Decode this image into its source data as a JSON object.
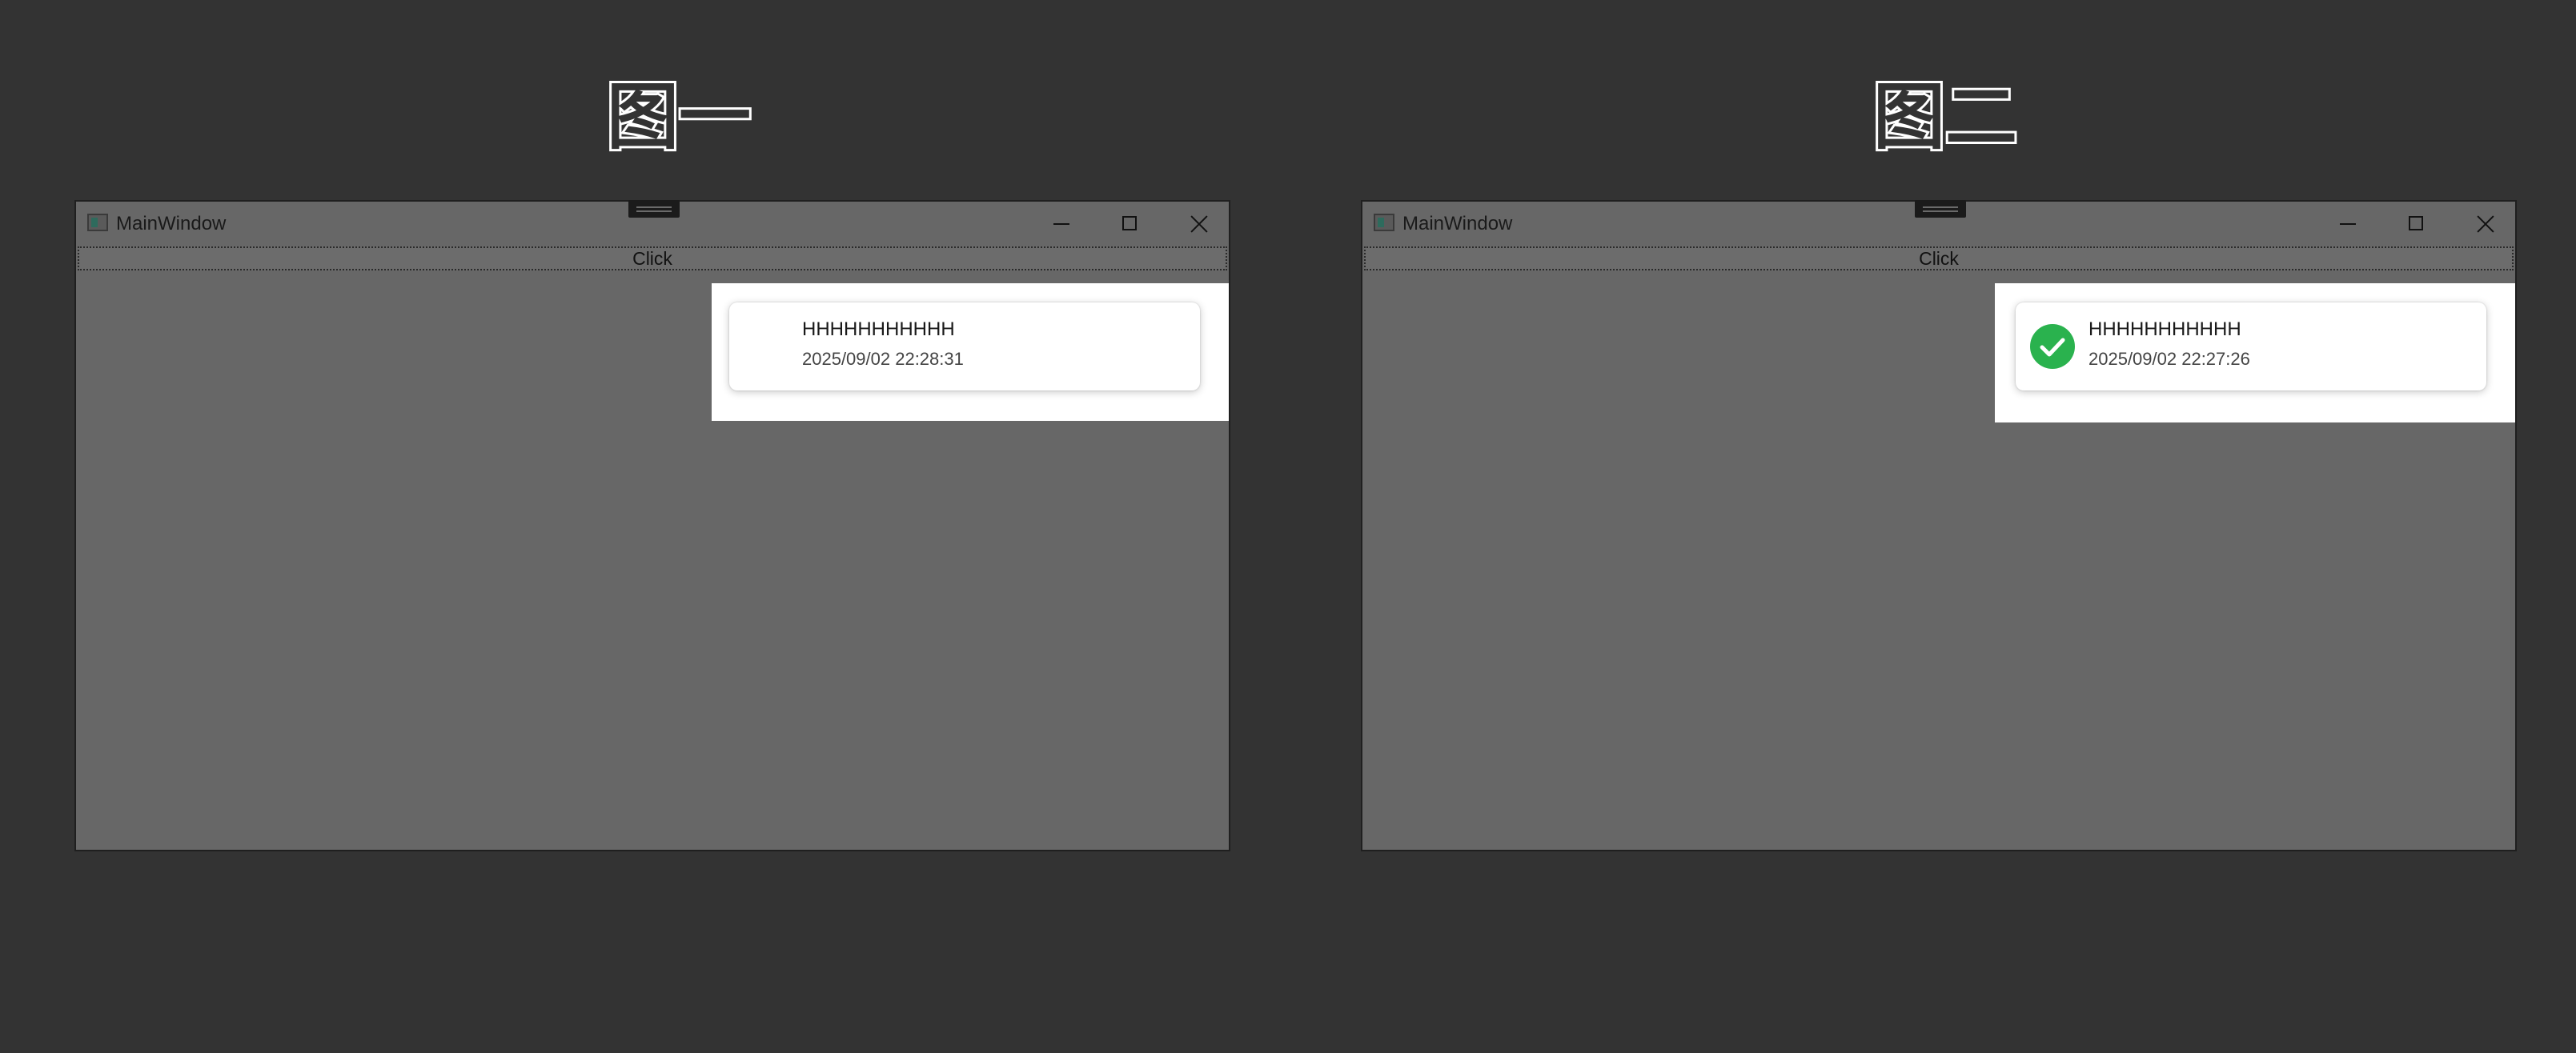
{
  "figures": [
    {
      "caption": "图一",
      "window": {
        "title": "MainWindow",
        "button_label": "Click"
      },
      "toast": {
        "title": "HHHHHHHHHHH",
        "timestamp": "2025/09/02 22:28:31",
        "icon": "none"
      }
    },
    {
      "caption": "图二",
      "window": {
        "title": "MainWindow",
        "button_label": "Click"
      },
      "toast": {
        "title": "HHHHHHHHHHH",
        "timestamp": "2025/09/02 22:27:26",
        "icon": "check-circle-icon",
        "icon_color": "#2ab24e"
      }
    }
  ],
  "colors": {
    "background": "#333333",
    "window": "#676767",
    "popup": "#ffffff"
  }
}
